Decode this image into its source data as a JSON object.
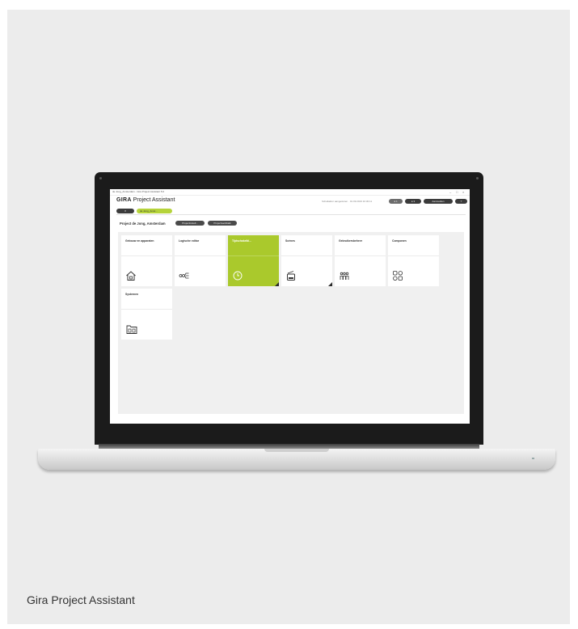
{
  "caption": "Gira Project Assistant",
  "app": {
    "window_title": "de Jong_Amsterdam - Gira Project Assistant 5.0",
    "window_controls": [
      "–",
      "□",
      "×"
    ],
    "brand": "GIRA",
    "product": "Project Assistant",
    "status_text": "Schaltaktor aangesloten · 01.09.2019 10:30:11",
    "header_buttons": [
      "● 1",
      "● 3",
      "Aanmelden",
      "?"
    ],
    "tab_close": "×",
    "active_tab": "de Jong_Amst...",
    "project_title": "Project de Jong, Amsterdam",
    "project_buttons": [
      "Projectinstell...",
      "Projectwerkbalk"
    ],
    "tiles": [
      {
        "label": "Gebouw en apparaten",
        "icon": "house-icon",
        "active": false,
        "corner": false
      },
      {
        "label": "Logische editor",
        "icon": "logic-nodes-icon",
        "active": false,
        "corner": false
      },
      {
        "label": "Tijdschakelkl...",
        "icon": "clock-icon",
        "active": true,
        "corner": true
      },
      {
        "label": "Scènes",
        "icon": "remote-icon",
        "active": false,
        "corner": true
      },
      {
        "label": "Gebruikersbeheer",
        "icon": "users-icon",
        "active": false,
        "corner": false
      },
      {
        "label": "Componen",
        "icon": "components-icon",
        "active": false,
        "corner": false
      },
      {
        "label": "Systemen",
        "icon": "system-folder-icon",
        "active": false,
        "corner": false
      }
    ]
  },
  "colors": {
    "accent": "#aac92c",
    "active_tab": "#b5d33a",
    "dark_pill": "#3b3b3b",
    "panel_bg": "#ececec",
    "bezel": "#1b1b1b"
  }
}
